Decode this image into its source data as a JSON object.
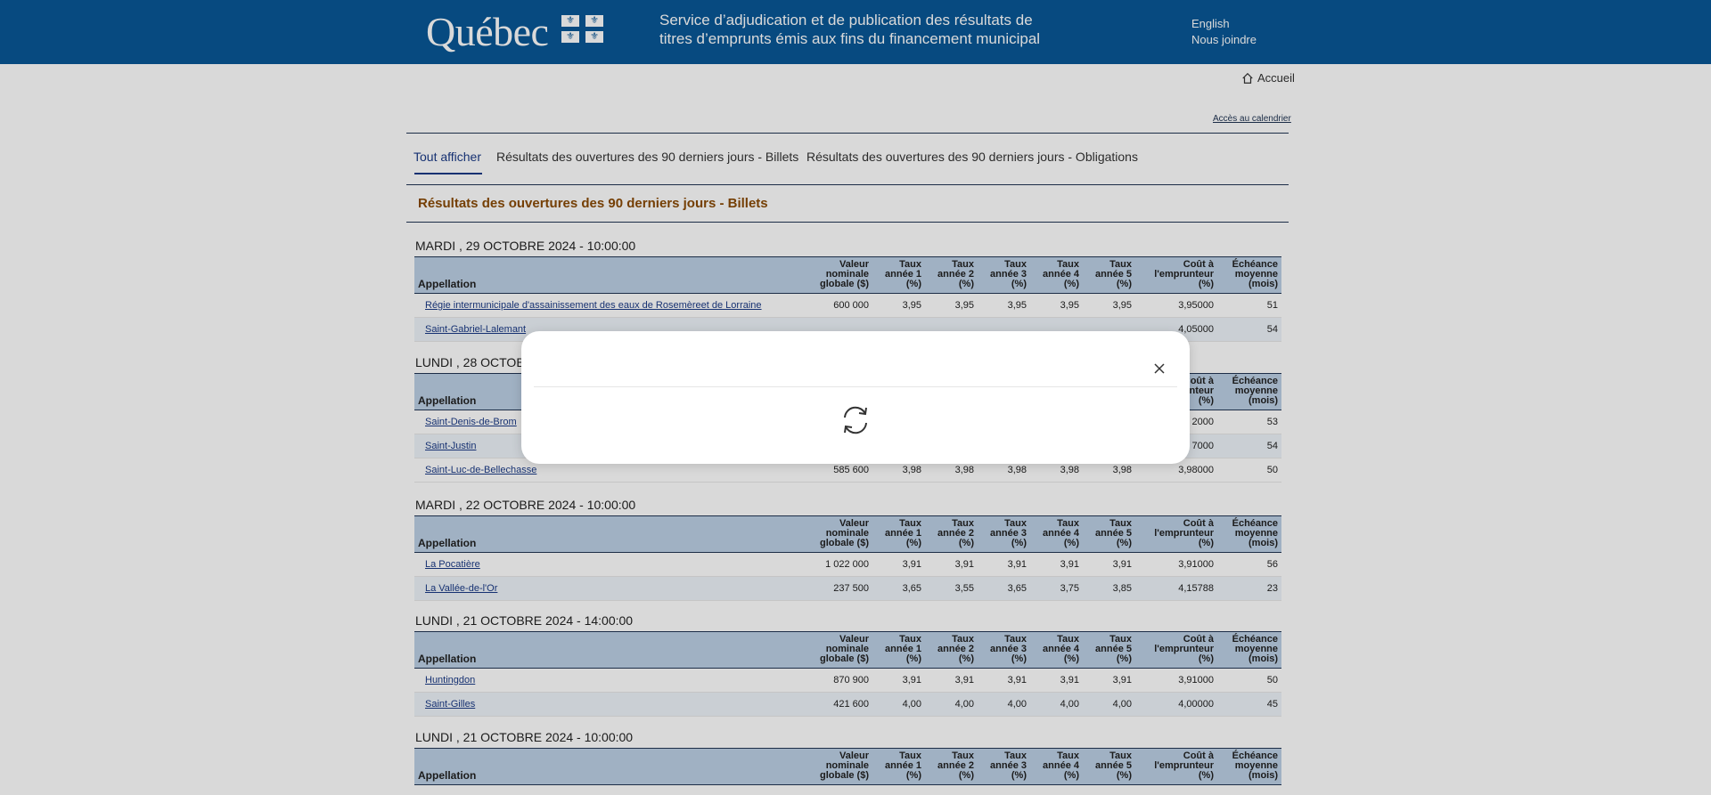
{
  "header": {
    "logo": "Québec",
    "service_title": "Service d’adjudication et de publication des résultats de titres d’emprunts émis aux fins du financement municipal",
    "links": [
      "English",
      "Nous joindre"
    ]
  },
  "nav": {
    "home": "Accueil",
    "calendar": "Accès au calendrier"
  },
  "tabs": [
    "Tout afficher",
    "Résultats des ouvertures des 90 derniers jours - Billets",
    "Résultats des ouvertures des 90 derniers jours - Obligations"
  ],
  "section_title": "Résultats des ouvertures des 90 derniers jours - Billets",
  "columns": {
    "appellation": "Appellation",
    "valeur": [
      "Valeur",
      "nominale",
      "globale ($)"
    ],
    "t1": [
      "Taux",
      "année 1",
      "(%)"
    ],
    "t2": [
      "Taux",
      "année 2",
      "(%)"
    ],
    "t3": [
      "Taux",
      "année 3",
      "(%)"
    ],
    "t4": [
      "Taux",
      "année 4",
      "(%)"
    ],
    "t5": [
      "Taux",
      "année 5",
      "(%)"
    ],
    "cout": [
      "Coût à",
      "l'emprunteur",
      "(%)"
    ],
    "ech": [
      "Échéance",
      "moyenne",
      "(mois)"
    ]
  },
  "groups": [
    {
      "date": "MARDI , 29 OCTOBRE 2024 - 10:00:00",
      "rows": [
        [
          "Régie intermunicipale d'assainissement des eaux de Rosemèreet de Lorraine",
          "600 000",
          "3,95",
          "3,95",
          "3,95",
          "3,95",
          "3,95",
          "3,95000",
          "51"
        ],
        [
          "Saint-Gabriel-Lalemant",
          "",
          "",
          "",
          "",
          "",
          "",
          "4,05000",
          "54"
        ]
      ]
    },
    {
      "date": "LUNDI , 28 OCTOBR",
      "rows": [
        [
          "Saint-Denis-de-Brom",
          "",
          "",
          "",
          "",
          "",
          "",
          "2000",
          "53"
        ],
        [
          "Saint-Justin",
          "",
          "",
          "",
          "",
          "",
          "",
          "7000",
          "54"
        ],
        [
          "Saint-Luc-de-Bellechasse",
          "585 600",
          "3,98",
          "3,98",
          "3,98",
          "3,98",
          "3,98",
          "3,98000",
          "50"
        ]
      ]
    },
    {
      "date": "MARDI , 22 OCTOBRE 2024 - 10:00:00",
      "rows": [
        [
          "La Pocatière",
          "1 022 000",
          "3,91",
          "3,91",
          "3,91",
          "3,91",
          "3,91",
          "3,91000",
          "56"
        ],
        [
          "La Vallée-de-l'Or",
          "237 500",
          "3,65",
          "3,55",
          "3,65",
          "3,75",
          "3,85",
          "4,15788",
          "23"
        ]
      ]
    },
    {
      "date": "LUNDI , 21 OCTOBRE 2024 - 14:00:00",
      "rows": [
        [
          "Huntingdon",
          "870 900",
          "3,91",
          "3,91",
          "3,91",
          "3,91",
          "3,91",
          "3,91000",
          "50"
        ],
        [
          "Saint-Gilles",
          "421 600",
          "4,00",
          "4,00",
          "4,00",
          "4,00",
          "4,00",
          "4,00000",
          "45"
        ]
      ]
    },
    {
      "date": "LUNDI , 21 OCTOBRE 2024 - 10:00:00",
      "rows": []
    }
  ],
  "modal": {
    "close_icon": "close-icon",
    "spinner_icon": "refresh-icon"
  }
}
